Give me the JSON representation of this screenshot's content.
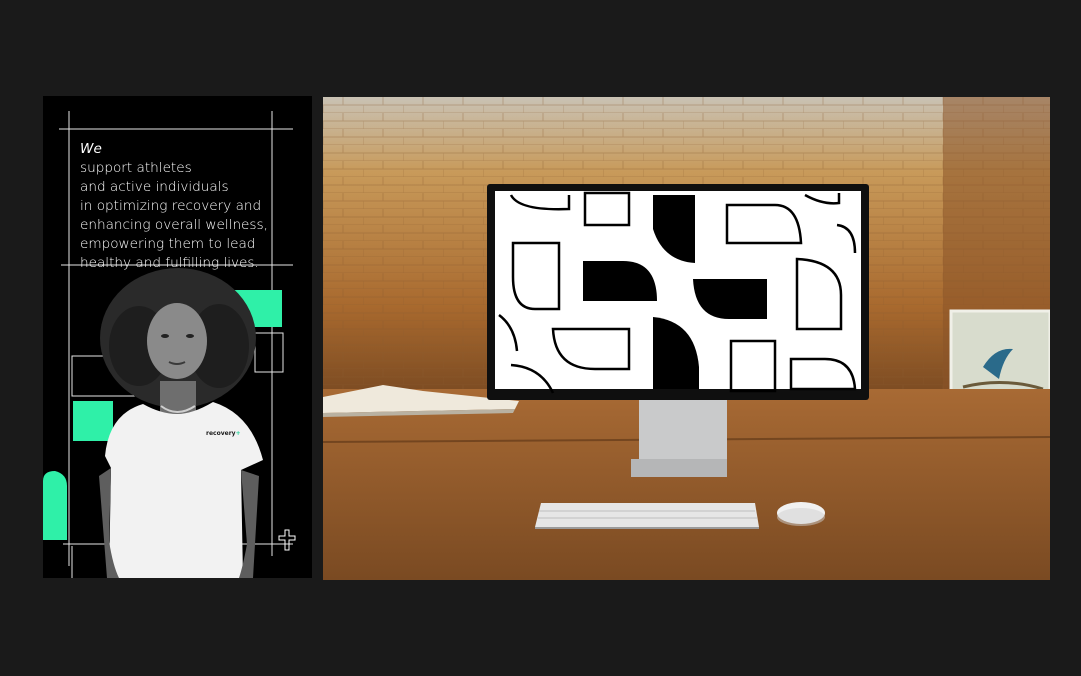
{
  "poster": {
    "tagline_lines": [
      "We support athletes",
      "and active individuals",
      "in optimizing recovery and",
      "enhancing overall wellness,",
      "empowering them to lead",
      "healthy and fulfilling lives."
    ],
    "tagline_lead_word": "We",
    "tagline_first_rest": " support athletes",
    "shirt_logo_text": "recovery",
    "shirt_logo_mark": "+",
    "accent_color": "#2ff0a8",
    "icon": "plus-cross-icon"
  },
  "mockup": {
    "scene": "desk-with-monitor",
    "screen_pattern_icon": "geometric-pattern-icon",
    "keyboard_icon": "keyboard-icon",
    "mouse_icon": "mouse-icon",
    "book_icon": "open-book-icon",
    "painting_icon": "bird-painting-icon"
  }
}
